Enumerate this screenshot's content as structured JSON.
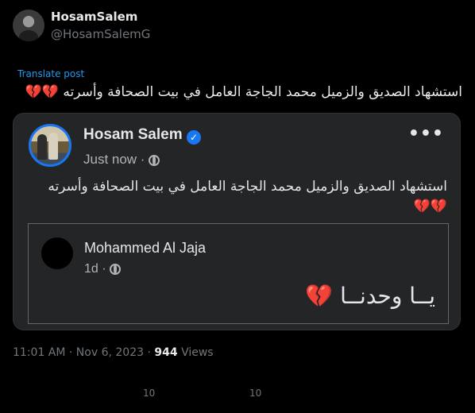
{
  "author": {
    "display_name": "HosamSalem",
    "handle": "@HosamSalemG"
  },
  "translate_label": "Translate post",
  "tweet_text": "استشهاد الصديق والزميل محمد الجاجة العامل في بيت الصحافة وأسرته",
  "tweet_emoji": "💔💔",
  "fb_post": {
    "name": "Hosam Salem",
    "time": "Just now ·",
    "text": "استشهاد الصديق والزميل محمد الجاجة العامل في بيت الصحافة وأسرته",
    "emoji": "💔💔",
    "more_label": "•••",
    "quoted": {
      "name": "Mohammed Al Jaja",
      "time": "1d ·",
      "text": "يــا وحدنــا",
      "emoji": "💔"
    }
  },
  "meta": {
    "time": "11:01 AM · Nov 6, 2023 ·",
    "views_count": "944",
    "views_label": "Views"
  },
  "action_counts": [
    "10",
    "10"
  ],
  "colors": {
    "background": "#000000",
    "card": "#242526",
    "link": "#1d9bf0",
    "verified": "#1877f2",
    "heart": "#e0245e"
  }
}
